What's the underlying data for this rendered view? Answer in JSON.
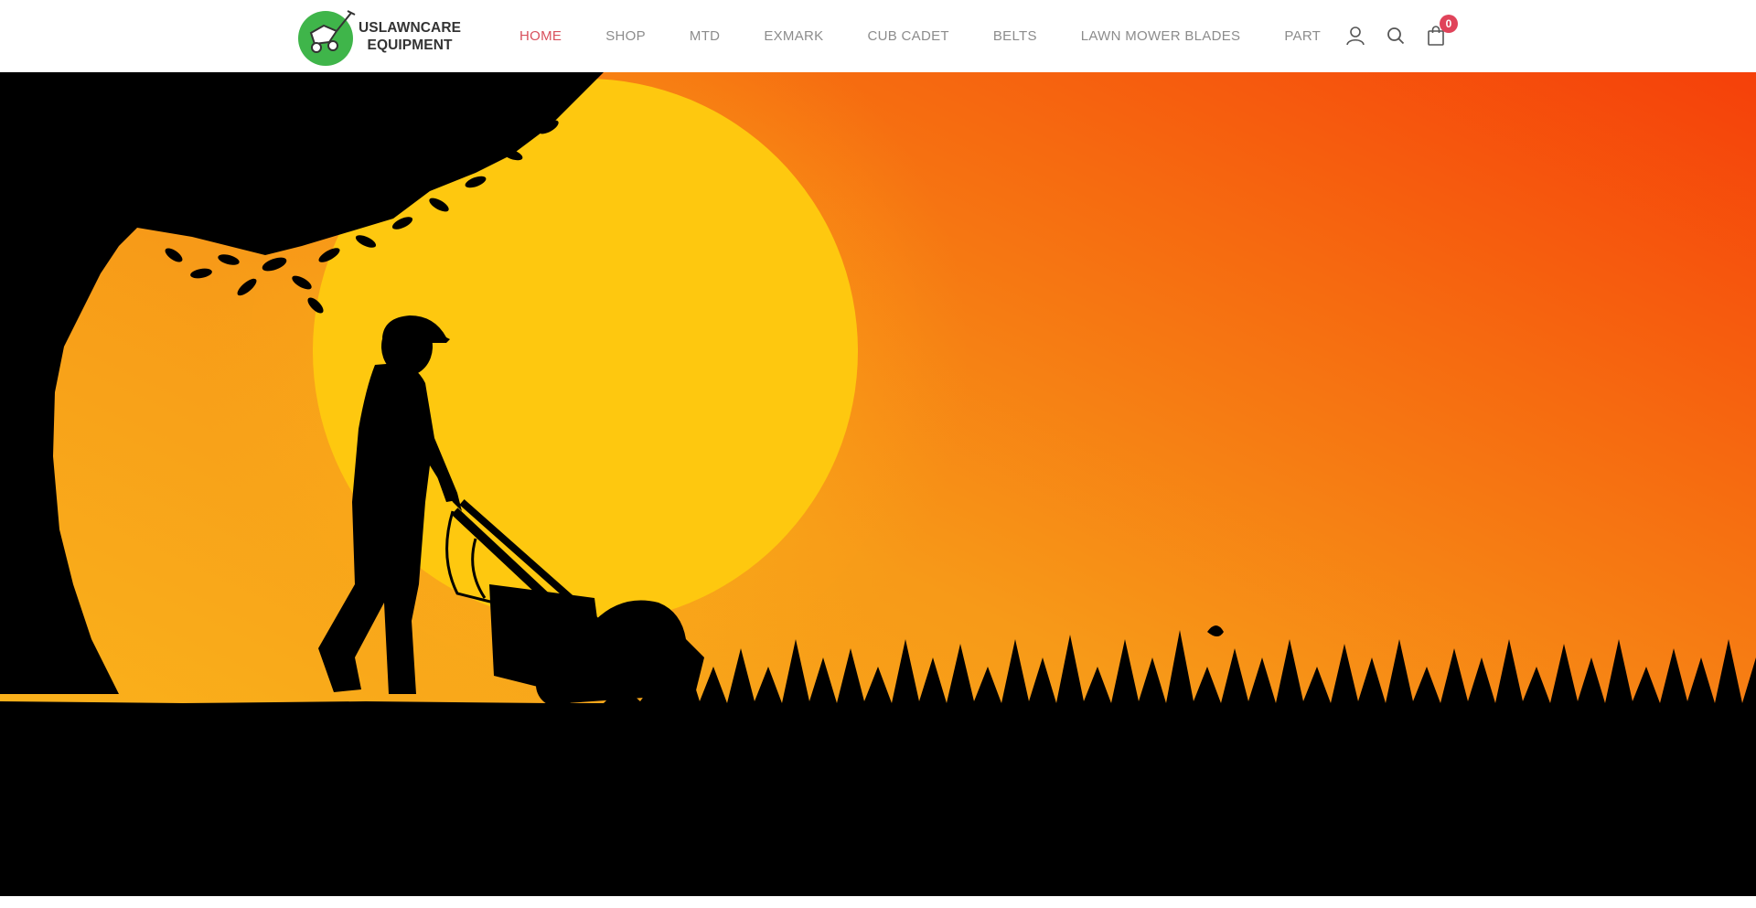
{
  "brand": {
    "name_line1": "USLAWNCARE",
    "name_line2": "EQUIPMENT",
    "logo_color": "#3fb54a"
  },
  "nav": {
    "items": [
      {
        "label": "HOME",
        "active": true
      },
      {
        "label": "SHOP",
        "active": false
      },
      {
        "label": "MTD",
        "active": false
      },
      {
        "label": "EXMARK",
        "active": false
      },
      {
        "label": "CUB CADET",
        "active": false
      },
      {
        "label": "BELTS",
        "active": false
      },
      {
        "label": "LAWN MOWER BLADES",
        "active": false
      },
      {
        "label": "PART",
        "active": false
      }
    ],
    "active_color": "#d8505c",
    "text_color": "#8c8c8c"
  },
  "header_icons": {
    "account": "user-icon",
    "search": "search-icon",
    "cart": "shopping-bag-icon",
    "cart_count": "0",
    "badge_color": "#e0435a"
  },
  "hero": {
    "image": "silhouette of a man pushing a lawn mower under a tree at sunset",
    "sun_color": "#ffc80f",
    "sky_colors": [
      "#f7a31a",
      "#f5410a"
    ]
  }
}
